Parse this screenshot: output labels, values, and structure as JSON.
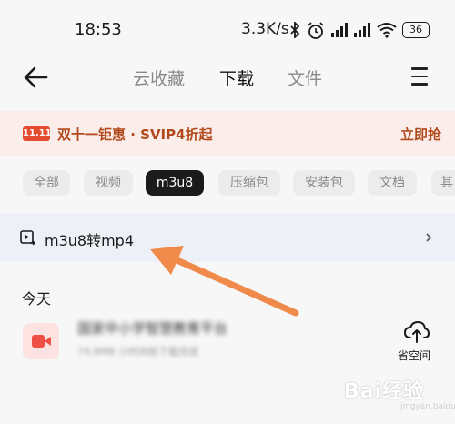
{
  "status_bar": {
    "time": "18:53",
    "speed": "3.3K/s",
    "battery": "36"
  },
  "nav": {
    "tabs": [
      {
        "label": "云收藏",
        "active": false
      },
      {
        "label": "下载",
        "active": true
      },
      {
        "label": "文件",
        "active": false
      }
    ]
  },
  "promo": {
    "badge": "11.11",
    "text": "双十一钜惠 · SVIP4折起",
    "action": "立即抢"
  },
  "filters": {
    "chips": [
      {
        "label": "全部",
        "active": false
      },
      {
        "label": "视频",
        "active": false
      },
      {
        "label": "m3u8",
        "active": true
      },
      {
        "label": "压缩包",
        "active": false
      },
      {
        "label": "安装包",
        "active": false
      },
      {
        "label": "文档",
        "active": false
      },
      {
        "label": "其",
        "active": false
      }
    ]
  },
  "convert": {
    "label": "m3u8转mp4"
  },
  "list": {
    "section": "今天",
    "file": {
      "name": "国家中小学智慧教育平台",
      "meta": "74.8MB   小时间前下载完成"
    },
    "save_space": "省空间"
  },
  "watermark": {
    "text": "Bai经验",
    "sub": "jingyan.baidu.com"
  },
  "colors": {
    "accent_red": "#e44b2f",
    "promo_bg": "#fbeeea",
    "promo_text": "#b2491d",
    "annotation_arrow": "#f08a4b"
  },
  "icons": [
    "back-arrow-icon",
    "menu-icon",
    "bluetooth-icon",
    "alarm-icon",
    "signal-icon",
    "wifi-icon",
    "battery-icon",
    "convert-icon",
    "chevron-right-icon",
    "video-file-icon",
    "cloud-upload-icon"
  ]
}
